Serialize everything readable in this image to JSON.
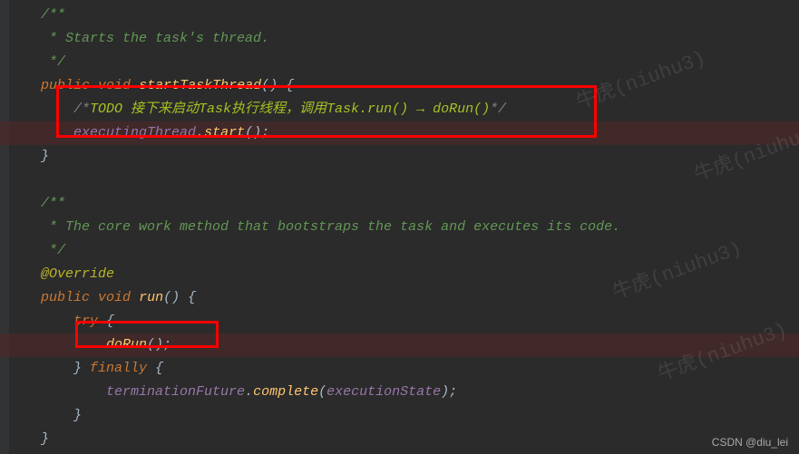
{
  "code": {
    "doc1_line1": "/**",
    "doc1_line2": " * Starts the task's thread.",
    "doc1_line3": " */",
    "public": "public",
    "void": "void",
    "startTaskThread": "startTaskThread",
    "parens": "()",
    "brace_open": " {",
    "brace_close": "}",
    "todo_open": "/*",
    "todo_label": "TODO ",
    "todo_text_cn": "接下来启动Task执行线程，调用Task.run() → doRun()",
    "todo_close": "*/",
    "executingThread": "executingThread",
    "dot": ".",
    "start": "start",
    "call_end": "();",
    "doc2_line1": "/**",
    "doc2_line2": " * The core work method that bootstraps the task and executes its code.",
    "doc2_line3": " */",
    "override": "@Override",
    "run": "run",
    "try": "try",
    "doRun": "doRun",
    "finally": "finally",
    "terminationFuture": "terminationFuture",
    "complete": "complete",
    "executionState": "executionState",
    "complete_end": ");",
    "open_paren": "("
  },
  "watermark": "牛虎(niuhu3)",
  "credit": "CSDN @diu_lei"
}
